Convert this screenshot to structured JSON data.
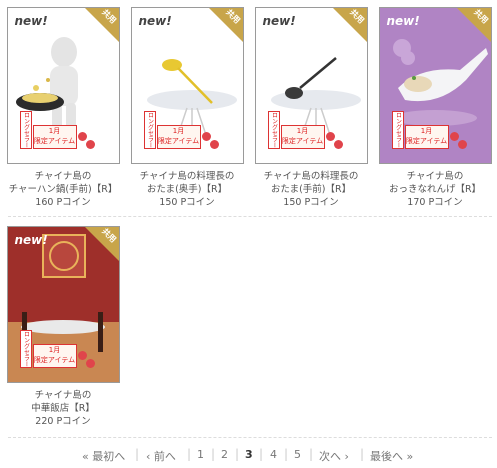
{
  "items": [
    {
      "badge": "new!",
      "shared": "共用",
      "name_line1": "チャイナ島の",
      "name_line2": "チャーハン鍋(手前)【R】",
      "price": "160 Pコイン",
      "limited_month": "1月",
      "limited_text": "限定アイテム",
      "vertical_text": "ロングセラー"
    },
    {
      "badge": "new!",
      "shared": "共用",
      "name_line1": "チャイナ島の料理長の",
      "name_line2": "おたま(奥手)【R】",
      "price": "150 Pコイン",
      "limited_month": "1月",
      "limited_text": "限定アイテム",
      "vertical_text": "ロングセラー"
    },
    {
      "badge": "new!",
      "shared": "共用",
      "name_line1": "チャイナ島の料理長の",
      "name_line2": "おたま(手前)【R】",
      "price": "150 Pコイン",
      "limited_month": "1月",
      "limited_text": "限定アイテム",
      "vertical_text": "ロングセラー"
    },
    {
      "badge": "new!",
      "shared": "共用",
      "name_line1": "チャイナ島の",
      "name_line2": "おっきなれんげ【R】",
      "price": "170 Pコイン",
      "limited_month": "1月",
      "limited_text": "限定アイテム",
      "vertical_text": "ロングセラー"
    },
    {
      "badge": "new!",
      "shared": "共用",
      "name_line1": "チャイナ島の",
      "name_line2": "中華飯店【R】",
      "price": "220 Pコイン",
      "limited_month": "1月",
      "limited_text": "限定アイテム",
      "vertical_text": "ロングセラー"
    }
  ],
  "pagination": {
    "first": "« 最初へ",
    "prev": "‹ 前へ",
    "pages": [
      "1",
      "2",
      "3",
      "4",
      "5"
    ],
    "current": "3",
    "next": "次へ ›",
    "last": "最後へ »"
  },
  "colors": {
    "purple_bg": "#b084c4",
    "shared_gold": "#c8a54a",
    "restaurant_red": "#a2352e"
  }
}
